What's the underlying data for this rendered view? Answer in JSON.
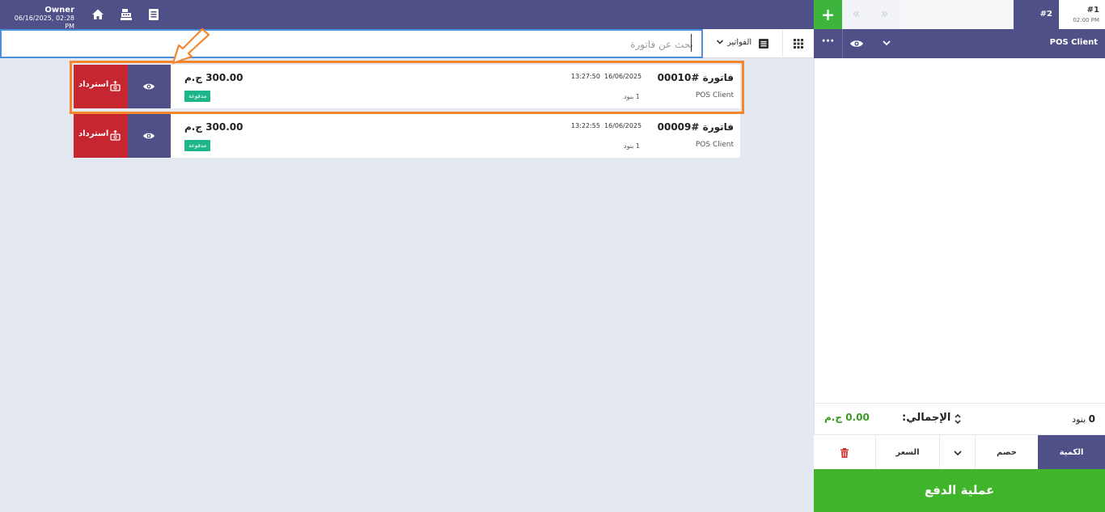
{
  "topbar": {
    "user_name": "Owner",
    "user_datetime": "06/16/2025, 02:28 PM",
    "icons": [
      "home-icon",
      "cash-register-icon",
      "receipt-icon"
    ]
  },
  "tabs": {
    "add_label": "+",
    "prev_label": "«",
    "next_label": "»",
    "orders": [
      {
        "number": "#2"
      },
      {
        "number": "#1",
        "time": "02:00 PM"
      }
    ]
  },
  "search": {
    "placeholder": "بحث عن فاتورة",
    "value": "",
    "filter_label": "الفواتير"
  },
  "cart": {
    "more_label": "···",
    "client_name": "POS Client",
    "items_count": "0",
    "items_label": "بنود",
    "total_label": "الإجمالي:",
    "total_value": "0.00 ج.م",
    "controls": {
      "quantity": "الكمية",
      "discount": "خصم",
      "price": "السعر"
    },
    "pay_label": "عملية الدفع"
  },
  "invoices": [
    {
      "number": "فاتورة #00010",
      "client": "POS Client",
      "date": "16/06/2025",
      "time": "13:27:50",
      "items": "1 بنود",
      "amount": "300.00 ج.م",
      "status": "مدفوعة",
      "refund_label": "استرداد"
    },
    {
      "number": "فاتورة #00009",
      "client": "POS Client",
      "date": "16/06/2025",
      "time": "13:22:55",
      "items": "1 بنود",
      "amount": "300.00 ج.م",
      "status": "مدفوعة",
      "refund_label": "استرداد"
    }
  ],
  "colors": {
    "primary": "#4e5087",
    "success": "#40b52c",
    "danger": "#c62630",
    "status_paid": "#1fb58a",
    "highlight": "#f5862e"
  }
}
